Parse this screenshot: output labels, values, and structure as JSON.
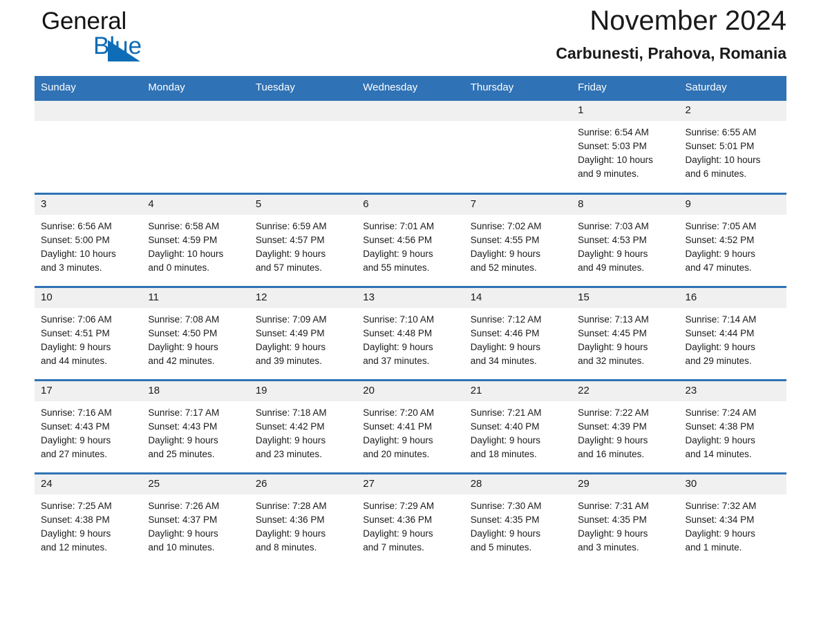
{
  "brand": {
    "name_part1": "General",
    "name_part2": "Blue",
    "triangle_icon": "triangle-icon",
    "accent_color": "#0f6cb6"
  },
  "header": {
    "title": "November 2024",
    "subtitle": "Carbunesti, Prahova, Romania",
    "header_bg_color": "#2f72b5",
    "daynum_bg_color": "#f0f0f0"
  },
  "weekdays": [
    "Sunday",
    "Monday",
    "Tuesday",
    "Wednesday",
    "Thursday",
    "Friday",
    "Saturday"
  ],
  "weeks": [
    [
      {
        "day": "",
        "empty": true
      },
      {
        "day": "",
        "empty": true
      },
      {
        "day": "",
        "empty": true
      },
      {
        "day": "",
        "empty": true
      },
      {
        "day": "",
        "empty": true
      },
      {
        "day": "1",
        "sunrise": "Sunrise: 6:54 AM",
        "sunset": "Sunset: 5:03 PM",
        "daylight1": "Daylight: 10 hours",
        "daylight2": "and 9 minutes."
      },
      {
        "day": "2",
        "sunrise": "Sunrise: 6:55 AM",
        "sunset": "Sunset: 5:01 PM",
        "daylight1": "Daylight: 10 hours",
        "daylight2": "and 6 minutes."
      }
    ],
    [
      {
        "day": "3",
        "sunrise": "Sunrise: 6:56 AM",
        "sunset": "Sunset: 5:00 PM",
        "daylight1": "Daylight: 10 hours",
        "daylight2": "and 3 minutes."
      },
      {
        "day": "4",
        "sunrise": "Sunrise: 6:58 AM",
        "sunset": "Sunset: 4:59 PM",
        "daylight1": "Daylight: 10 hours",
        "daylight2": "and 0 minutes."
      },
      {
        "day": "5",
        "sunrise": "Sunrise: 6:59 AM",
        "sunset": "Sunset: 4:57 PM",
        "daylight1": "Daylight: 9 hours",
        "daylight2": "and 57 minutes."
      },
      {
        "day": "6",
        "sunrise": "Sunrise: 7:01 AM",
        "sunset": "Sunset: 4:56 PM",
        "daylight1": "Daylight: 9 hours",
        "daylight2": "and 55 minutes."
      },
      {
        "day": "7",
        "sunrise": "Sunrise: 7:02 AM",
        "sunset": "Sunset: 4:55 PM",
        "daylight1": "Daylight: 9 hours",
        "daylight2": "and 52 minutes."
      },
      {
        "day": "8",
        "sunrise": "Sunrise: 7:03 AM",
        "sunset": "Sunset: 4:53 PM",
        "daylight1": "Daylight: 9 hours",
        "daylight2": "and 49 minutes."
      },
      {
        "day": "9",
        "sunrise": "Sunrise: 7:05 AM",
        "sunset": "Sunset: 4:52 PM",
        "daylight1": "Daylight: 9 hours",
        "daylight2": "and 47 minutes."
      }
    ],
    [
      {
        "day": "10",
        "sunrise": "Sunrise: 7:06 AM",
        "sunset": "Sunset: 4:51 PM",
        "daylight1": "Daylight: 9 hours",
        "daylight2": "and 44 minutes."
      },
      {
        "day": "11",
        "sunrise": "Sunrise: 7:08 AM",
        "sunset": "Sunset: 4:50 PM",
        "daylight1": "Daylight: 9 hours",
        "daylight2": "and 42 minutes."
      },
      {
        "day": "12",
        "sunrise": "Sunrise: 7:09 AM",
        "sunset": "Sunset: 4:49 PM",
        "daylight1": "Daylight: 9 hours",
        "daylight2": "and 39 minutes."
      },
      {
        "day": "13",
        "sunrise": "Sunrise: 7:10 AM",
        "sunset": "Sunset: 4:48 PM",
        "daylight1": "Daylight: 9 hours",
        "daylight2": "and 37 minutes."
      },
      {
        "day": "14",
        "sunrise": "Sunrise: 7:12 AM",
        "sunset": "Sunset: 4:46 PM",
        "daylight1": "Daylight: 9 hours",
        "daylight2": "and 34 minutes."
      },
      {
        "day": "15",
        "sunrise": "Sunrise: 7:13 AM",
        "sunset": "Sunset: 4:45 PM",
        "daylight1": "Daylight: 9 hours",
        "daylight2": "and 32 minutes."
      },
      {
        "day": "16",
        "sunrise": "Sunrise: 7:14 AM",
        "sunset": "Sunset: 4:44 PM",
        "daylight1": "Daylight: 9 hours",
        "daylight2": "and 29 minutes."
      }
    ],
    [
      {
        "day": "17",
        "sunrise": "Sunrise: 7:16 AM",
        "sunset": "Sunset: 4:43 PM",
        "daylight1": "Daylight: 9 hours",
        "daylight2": "and 27 minutes."
      },
      {
        "day": "18",
        "sunrise": "Sunrise: 7:17 AM",
        "sunset": "Sunset: 4:43 PM",
        "daylight1": "Daylight: 9 hours",
        "daylight2": "and 25 minutes."
      },
      {
        "day": "19",
        "sunrise": "Sunrise: 7:18 AM",
        "sunset": "Sunset: 4:42 PM",
        "daylight1": "Daylight: 9 hours",
        "daylight2": "and 23 minutes."
      },
      {
        "day": "20",
        "sunrise": "Sunrise: 7:20 AM",
        "sunset": "Sunset: 4:41 PM",
        "daylight1": "Daylight: 9 hours",
        "daylight2": "and 20 minutes."
      },
      {
        "day": "21",
        "sunrise": "Sunrise: 7:21 AM",
        "sunset": "Sunset: 4:40 PM",
        "daylight1": "Daylight: 9 hours",
        "daylight2": "and 18 minutes."
      },
      {
        "day": "22",
        "sunrise": "Sunrise: 7:22 AM",
        "sunset": "Sunset: 4:39 PM",
        "daylight1": "Daylight: 9 hours",
        "daylight2": "and 16 minutes."
      },
      {
        "day": "23",
        "sunrise": "Sunrise: 7:24 AM",
        "sunset": "Sunset: 4:38 PM",
        "daylight1": "Daylight: 9 hours",
        "daylight2": "and 14 minutes."
      }
    ],
    [
      {
        "day": "24",
        "sunrise": "Sunrise: 7:25 AM",
        "sunset": "Sunset: 4:38 PM",
        "daylight1": "Daylight: 9 hours",
        "daylight2": "and 12 minutes."
      },
      {
        "day": "25",
        "sunrise": "Sunrise: 7:26 AM",
        "sunset": "Sunset: 4:37 PM",
        "daylight1": "Daylight: 9 hours",
        "daylight2": "and 10 minutes."
      },
      {
        "day": "26",
        "sunrise": "Sunrise: 7:28 AM",
        "sunset": "Sunset: 4:36 PM",
        "daylight1": "Daylight: 9 hours",
        "daylight2": "and 8 minutes."
      },
      {
        "day": "27",
        "sunrise": "Sunrise: 7:29 AM",
        "sunset": "Sunset: 4:36 PM",
        "daylight1": "Daylight: 9 hours",
        "daylight2": "and 7 minutes."
      },
      {
        "day": "28",
        "sunrise": "Sunrise: 7:30 AM",
        "sunset": "Sunset: 4:35 PM",
        "daylight1": "Daylight: 9 hours",
        "daylight2": "and 5 minutes."
      },
      {
        "day": "29",
        "sunrise": "Sunrise: 7:31 AM",
        "sunset": "Sunset: 4:35 PM",
        "daylight1": "Daylight: 9 hours",
        "daylight2": "and 3 minutes."
      },
      {
        "day": "30",
        "sunrise": "Sunrise: 7:32 AM",
        "sunset": "Sunset: 4:34 PM",
        "daylight1": "Daylight: 9 hours",
        "daylight2": "and 1 minute."
      }
    ]
  ]
}
